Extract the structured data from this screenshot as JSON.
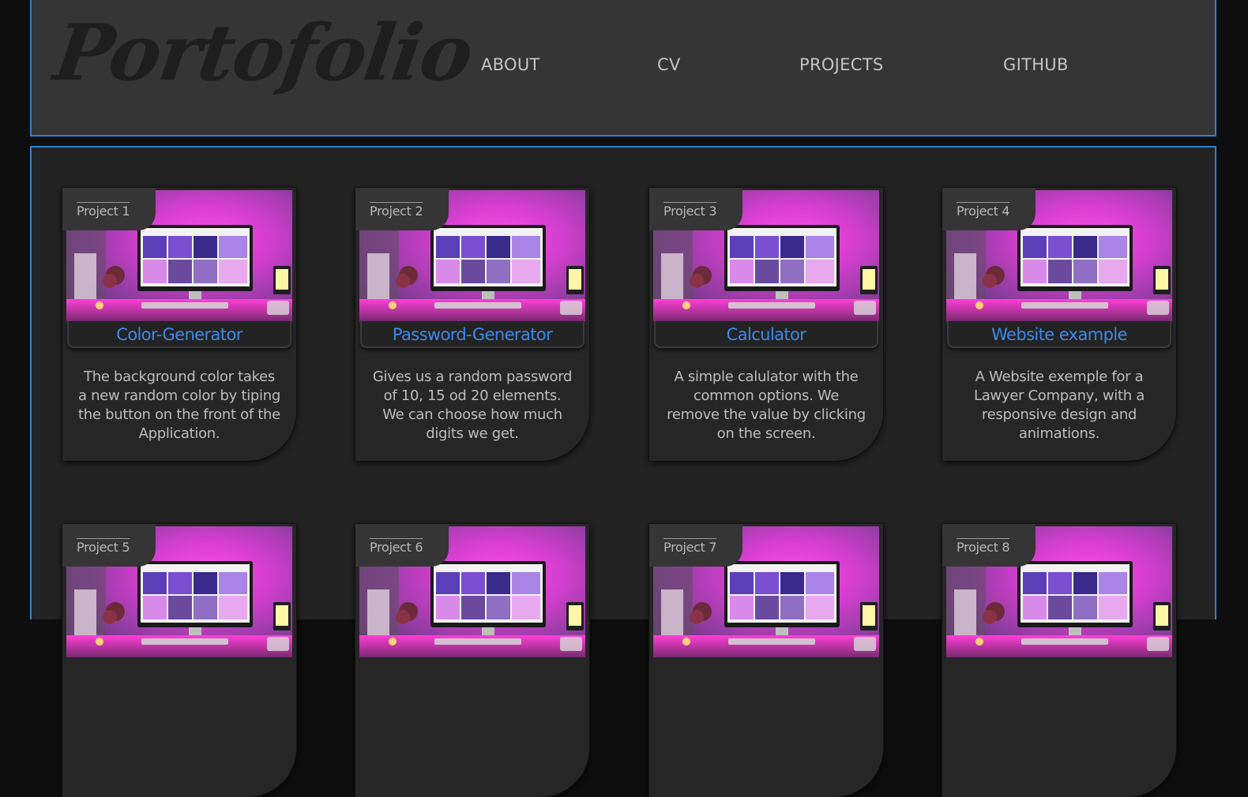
{
  "logo": "Portofolio",
  "nav": [
    "ABOUT",
    "CV",
    "PROJECTS",
    "GITHUB"
  ],
  "projects": [
    {
      "tag": "Project 1",
      "title": "Color-Generator",
      "desc": "The background color takes a new random color by tiping the button on the front of the Application."
    },
    {
      "tag": "Project 2",
      "title": "Password-Generator",
      "desc": "Gives us a random password of 10, 15 od 20 elements. We can choose how much digits we get."
    },
    {
      "tag": "Project 3",
      "title": "Calculator",
      "desc": "A simple calulator with the common options. We remove the value by clicking on the screen."
    },
    {
      "tag": "Project 4",
      "title": "Website example",
      "desc": "A Website exemple for a Lawyer Company, with a responsive design and animations."
    },
    {
      "tag": "Project 5"
    },
    {
      "tag": "Project 6"
    },
    {
      "tag": "Project 7"
    },
    {
      "tag": "Project 8"
    }
  ],
  "colors": {
    "accent": "#2f80d6",
    "title": "#3d89ea",
    "header_bg": "#353535",
    "main_bg": "#232323",
    "card_bg": "#262626",
    "text": "#c4c4c4"
  },
  "icons": {
    "thumbnail": "desk-setup-image"
  }
}
